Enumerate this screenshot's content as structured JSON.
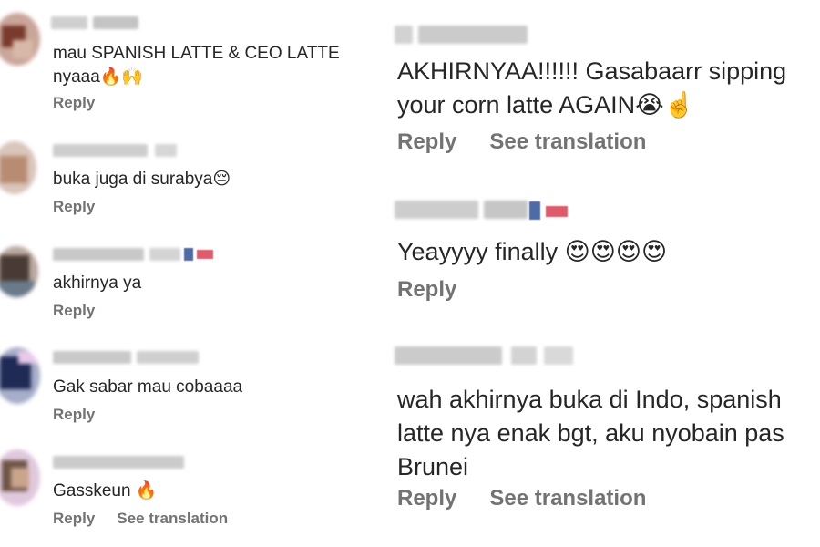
{
  "left_comments": [
    {
      "text": "mau SPANISH LATTE & CEO LATTE\nnyaaa🔥🙌",
      "actions": [
        "Reply"
      ]
    },
    {
      "text": "buka juga di surabya😔",
      "actions": [
        "Reply"
      ]
    },
    {
      "text": "akhirnya ya",
      "actions": [
        "Reply"
      ]
    },
    {
      "text": "Gak sabar mau cobaaaa",
      "actions": [
        "Reply"
      ]
    },
    {
      "text": "Gasskeun 🔥",
      "actions": [
        "Reply",
        "See translation"
      ]
    }
  ],
  "right_comments": [
    {
      "text": "AKHIRNYAA!!!!!! Gasabaarr sipping\nyour corn latte AGAIN😭☝️",
      "actions": [
        "Reply",
        "See translation"
      ]
    },
    {
      "text": "Yeayyyy finally 😍😍😍😍",
      "actions": [
        "Reply"
      ]
    },
    {
      "text": "wah akhirnya buka di Indo, spanish\nlatte nya enak bgt, aku nyobain pas\nBrunei",
      "actions": [
        "Reply",
        "See translation"
      ]
    }
  ],
  "colors": {
    "text": "#262626",
    "muted": "#737373",
    "blur": "#c8c8c8"
  },
  "icons": [
    "blurred-avatar",
    "indonesia-flag-icon"
  ]
}
